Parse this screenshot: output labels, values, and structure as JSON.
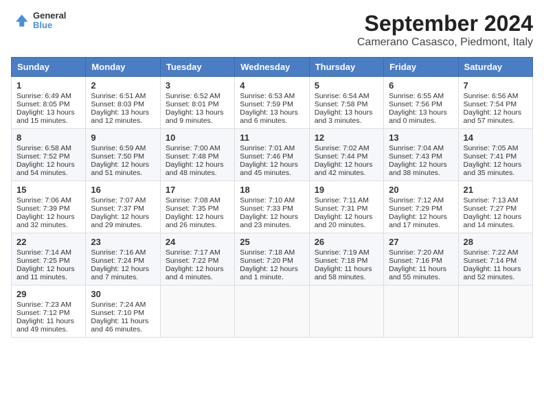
{
  "header": {
    "logo_line1": "General",
    "logo_line2": "Blue",
    "title": "September 2024",
    "subtitle": "Camerano Casasco, Piedmont, Italy"
  },
  "weekdays": [
    "Sunday",
    "Monday",
    "Tuesday",
    "Wednesday",
    "Thursday",
    "Friday",
    "Saturday"
  ],
  "weeks": [
    [
      {
        "day": "1",
        "lines": [
          "Sunrise: 6:49 AM",
          "Sunset: 8:05 PM",
          "Daylight: 13 hours",
          "and 15 minutes."
        ]
      },
      {
        "day": "2",
        "lines": [
          "Sunrise: 6:51 AM",
          "Sunset: 8:03 PM",
          "Daylight: 13 hours",
          "and 12 minutes."
        ]
      },
      {
        "day": "3",
        "lines": [
          "Sunrise: 6:52 AM",
          "Sunset: 8:01 PM",
          "Daylight: 13 hours",
          "and 9 minutes."
        ]
      },
      {
        "day": "4",
        "lines": [
          "Sunrise: 6:53 AM",
          "Sunset: 7:59 PM",
          "Daylight: 13 hours",
          "and 6 minutes."
        ]
      },
      {
        "day": "5",
        "lines": [
          "Sunrise: 6:54 AM",
          "Sunset: 7:58 PM",
          "Daylight: 13 hours",
          "and 3 minutes."
        ]
      },
      {
        "day": "6",
        "lines": [
          "Sunrise: 6:55 AM",
          "Sunset: 7:56 PM",
          "Daylight: 13 hours",
          "and 0 minutes."
        ]
      },
      {
        "day": "7",
        "lines": [
          "Sunrise: 6:56 AM",
          "Sunset: 7:54 PM",
          "Daylight: 12 hours",
          "and 57 minutes."
        ]
      }
    ],
    [
      {
        "day": "8",
        "lines": [
          "Sunrise: 6:58 AM",
          "Sunset: 7:52 PM",
          "Daylight: 12 hours",
          "and 54 minutes."
        ]
      },
      {
        "day": "9",
        "lines": [
          "Sunrise: 6:59 AM",
          "Sunset: 7:50 PM",
          "Daylight: 12 hours",
          "and 51 minutes."
        ]
      },
      {
        "day": "10",
        "lines": [
          "Sunrise: 7:00 AM",
          "Sunset: 7:48 PM",
          "Daylight: 12 hours",
          "and 48 minutes."
        ]
      },
      {
        "day": "11",
        "lines": [
          "Sunrise: 7:01 AM",
          "Sunset: 7:46 PM",
          "Daylight: 12 hours",
          "and 45 minutes."
        ]
      },
      {
        "day": "12",
        "lines": [
          "Sunrise: 7:02 AM",
          "Sunset: 7:44 PM",
          "Daylight: 12 hours",
          "and 42 minutes."
        ]
      },
      {
        "day": "13",
        "lines": [
          "Sunrise: 7:04 AM",
          "Sunset: 7:43 PM",
          "Daylight: 12 hours",
          "and 38 minutes."
        ]
      },
      {
        "day": "14",
        "lines": [
          "Sunrise: 7:05 AM",
          "Sunset: 7:41 PM",
          "Daylight: 12 hours",
          "and 35 minutes."
        ]
      }
    ],
    [
      {
        "day": "15",
        "lines": [
          "Sunrise: 7:06 AM",
          "Sunset: 7:39 PM",
          "Daylight: 12 hours",
          "and 32 minutes."
        ]
      },
      {
        "day": "16",
        "lines": [
          "Sunrise: 7:07 AM",
          "Sunset: 7:37 PM",
          "Daylight: 12 hours",
          "and 29 minutes."
        ]
      },
      {
        "day": "17",
        "lines": [
          "Sunrise: 7:08 AM",
          "Sunset: 7:35 PM",
          "Daylight: 12 hours",
          "and 26 minutes."
        ]
      },
      {
        "day": "18",
        "lines": [
          "Sunrise: 7:10 AM",
          "Sunset: 7:33 PM",
          "Daylight: 12 hours",
          "and 23 minutes."
        ]
      },
      {
        "day": "19",
        "lines": [
          "Sunrise: 7:11 AM",
          "Sunset: 7:31 PM",
          "Daylight: 12 hours",
          "and 20 minutes."
        ]
      },
      {
        "day": "20",
        "lines": [
          "Sunrise: 7:12 AM",
          "Sunset: 7:29 PM",
          "Daylight: 12 hours",
          "and 17 minutes."
        ]
      },
      {
        "day": "21",
        "lines": [
          "Sunrise: 7:13 AM",
          "Sunset: 7:27 PM",
          "Daylight: 12 hours",
          "and 14 minutes."
        ]
      }
    ],
    [
      {
        "day": "22",
        "lines": [
          "Sunrise: 7:14 AM",
          "Sunset: 7:25 PM",
          "Daylight: 12 hours",
          "and 11 minutes."
        ]
      },
      {
        "day": "23",
        "lines": [
          "Sunrise: 7:16 AM",
          "Sunset: 7:24 PM",
          "Daylight: 12 hours",
          "and 7 minutes."
        ]
      },
      {
        "day": "24",
        "lines": [
          "Sunrise: 7:17 AM",
          "Sunset: 7:22 PM",
          "Daylight: 12 hours",
          "and 4 minutes."
        ]
      },
      {
        "day": "25",
        "lines": [
          "Sunrise: 7:18 AM",
          "Sunset: 7:20 PM",
          "Daylight: 12 hours",
          "and 1 minute."
        ]
      },
      {
        "day": "26",
        "lines": [
          "Sunrise: 7:19 AM",
          "Sunset: 7:18 PM",
          "Daylight: 11 hours",
          "and 58 minutes."
        ]
      },
      {
        "day": "27",
        "lines": [
          "Sunrise: 7:20 AM",
          "Sunset: 7:16 PM",
          "Daylight: 11 hours",
          "and 55 minutes."
        ]
      },
      {
        "day": "28",
        "lines": [
          "Sunrise: 7:22 AM",
          "Sunset: 7:14 PM",
          "Daylight: 11 hours",
          "and 52 minutes."
        ]
      }
    ],
    [
      {
        "day": "29",
        "lines": [
          "Sunrise: 7:23 AM",
          "Sunset: 7:12 PM",
          "Daylight: 11 hours",
          "and 49 minutes."
        ]
      },
      {
        "day": "30",
        "lines": [
          "Sunrise: 7:24 AM",
          "Sunset: 7:10 PM",
          "Daylight: 11 hours",
          "and 46 minutes."
        ]
      },
      null,
      null,
      null,
      null,
      null
    ]
  ]
}
